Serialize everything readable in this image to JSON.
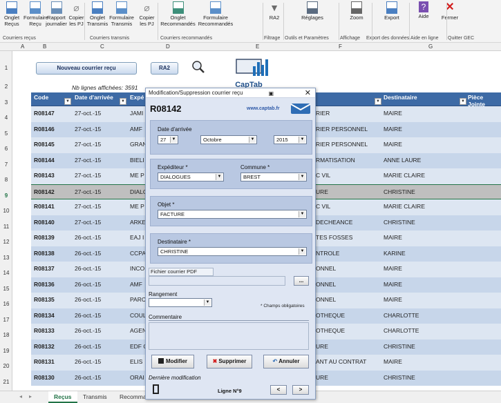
{
  "ribbon": {
    "buttons": [
      {
        "label": "Onglet\nReçus",
        "icon": "folder-icon"
      },
      {
        "label": "Formulaire\nReçu",
        "icon": "form-icon"
      },
      {
        "label": "Rapport\njournalier",
        "icon": "report-icon"
      },
      {
        "label": "Copier\nles PJ",
        "icon": "clip-icon"
      },
      {
        "label": "Onglet\nTransmis",
        "icon": "folder-icon"
      },
      {
        "label": "Formulaire\nTransmis",
        "icon": "form-icon"
      },
      {
        "label": "Copier\nles PJ",
        "icon": "clip-icon"
      },
      {
        "label": "Onglet\nRecommandés",
        "icon": "people-icon"
      },
      {
        "label": "Formulaire\nRecommandés",
        "icon": "form-icon"
      },
      {
        "label": "RA2",
        "icon": "filter-icon"
      },
      {
        "label": "Réglages",
        "icon": "tools-icon"
      },
      {
        "label": "Zoom",
        "icon": "zoom-icon"
      },
      {
        "label": "Export",
        "icon": "export-icon"
      },
      {
        "label": "Aide",
        "icon": "help-icon"
      },
      {
        "label": "Fermer",
        "icon": "close-icon"
      }
    ],
    "groups": [
      "Courriers reçus",
      "Courriers transmis",
      "Courriers recommandés",
      "Filtrage",
      "Outils et Paramètres",
      "Affichage",
      "Export des données",
      "Aide en ligne",
      "Quitter GEC"
    ]
  },
  "columns": [
    "A",
    "B",
    "C",
    "D",
    "E",
    "F",
    "G"
  ],
  "row_numbers": [
    "1",
    "2",
    "3",
    "4",
    "5",
    "6",
    "7",
    "8",
    "9",
    "10",
    "11",
    "12",
    "13",
    "14",
    "15",
    "16",
    "17",
    "18",
    "19",
    "20",
    "21"
  ],
  "sheet": {
    "new_button": "Nouveau courrier reçu",
    "ra2_button": "RA2",
    "logo_text": "CapTab",
    "nb_lignes": "Nb lignes affichées: 3591",
    "headers": {
      "code": "Code",
      "date": "Date d'arrivée",
      "exp": "Expé",
      "dest": "Destinataire",
      "pj": "Pièce Jointe"
    },
    "rows": [
      {
        "code": "R08147",
        "date": "27-oct.-15",
        "exp": "JAMI",
        "mid": "RIER",
        "dest": "MAIRE"
      },
      {
        "code": "R08146",
        "date": "27-oct.-15",
        "exp": "AMF",
        "mid": "RIER PERSONNEL",
        "dest": "MAIRE"
      },
      {
        "code": "R08145",
        "date": "27-oct.-15",
        "exp": "GRAN",
        "mid": "RIER PERSONNEL",
        "dest": "MAIRE"
      },
      {
        "code": "R08144",
        "date": "27-oct.-15",
        "exp": "BIELI",
        "mid": "RMATISATION",
        "dest": "ANNE LAURE"
      },
      {
        "code": "R08143",
        "date": "27-oct.-15",
        "exp": "ME P",
        "mid": "C VIL",
        "dest": "MARIE CLAIRE"
      },
      {
        "code": "R08142",
        "date": "27-oct.-15",
        "exp": "DIALO",
        "mid": "URE",
        "dest": "CHRISTINE"
      },
      {
        "code": "R08141",
        "date": "27-oct.-15",
        "exp": "ME P",
        "mid": "C VIL",
        "dest": "MARIE CLAIRE"
      },
      {
        "code": "R08140",
        "date": "27-oct.-15",
        "exp": "ARKE",
        "mid": "DECHEANCE",
        "dest": "CHRISTINE"
      },
      {
        "code": "R08139",
        "date": "26-oct.-15",
        "exp": "EAJ I",
        "mid": "TES FOSSES",
        "dest": "MAIRE"
      },
      {
        "code": "R08138",
        "date": "26-oct.-15",
        "exp": "CCPA",
        "mid": "NTROLE",
        "dest": "KARINE"
      },
      {
        "code": "R08137",
        "date": "26-oct.-15",
        "exp": "INCO",
        "mid": "ONNEL",
        "dest": "MAIRE"
      },
      {
        "code": "R08136",
        "date": "26-oct.-15",
        "exp": "AMF",
        "mid": "ONNEL",
        "dest": "MAIRE"
      },
      {
        "code": "R08135",
        "date": "26-oct.-15",
        "exp": "PARC",
        "mid": "ONNEL",
        "dest": "MAIRE"
      },
      {
        "code": "R08134",
        "date": "26-oct.-15",
        "exp": "COUL",
        "mid": "OTHEQUE",
        "dest": "CHARLOTTE"
      },
      {
        "code": "R08133",
        "date": "26-oct.-15",
        "exp": "AGEN",
        "mid": "OTHEQUE",
        "dest": "CHARLOTTE"
      },
      {
        "code": "R08132",
        "date": "26-oct.-15",
        "exp": "EDF C",
        "mid": "URE",
        "dest": "CHRISTINE"
      },
      {
        "code": "R08131",
        "date": "26-oct.-15",
        "exp": "ELIS",
        "mid": "ANT AU CONTRAT",
        "dest": "MAIRE"
      },
      {
        "code": "R08130",
        "date": "26-oct.-15",
        "exp": "ORAI",
        "mid": "URE",
        "dest": "CHRISTINE"
      }
    ],
    "tabs": [
      "Reçus",
      "Transmis",
      "Recomma"
    ]
  },
  "dialog": {
    "title": "Modification/Suppression courrier reçu",
    "code": "R08142",
    "website": "www.captab.fr",
    "date_label": "Date d'arrivée",
    "day": "27",
    "month": "Octobre",
    "year": "2015",
    "expediteur_label": "Expéditeur *",
    "expediteur": "DIALOGUES",
    "commune_label": "Commune *",
    "commune": "BREST",
    "objet_label": "Objet *",
    "objet": "FACTURE",
    "destinataire_label": "Destinataire *",
    "destinataire": "CHRISTINE",
    "pdf_label": "Fichier courrier PDF",
    "browse": "...",
    "rangement_label": "Rangement",
    "required_note": "* Champs obligatoires",
    "commentaire_label": "Commentaire",
    "btn_modifier": "Modifier",
    "btn_supprimer": "Supprimer",
    "btn_annuler": "Annuler",
    "last_mod": "Dernière modification",
    "ligne": "Ligne N°9",
    "prev": "<",
    "next": ">"
  },
  "colors": {
    "header_blue": "#3d6aa5",
    "row_light": "#dde6f2",
    "row_dark": "#c7d6ea",
    "excel_green": "#217346"
  }
}
